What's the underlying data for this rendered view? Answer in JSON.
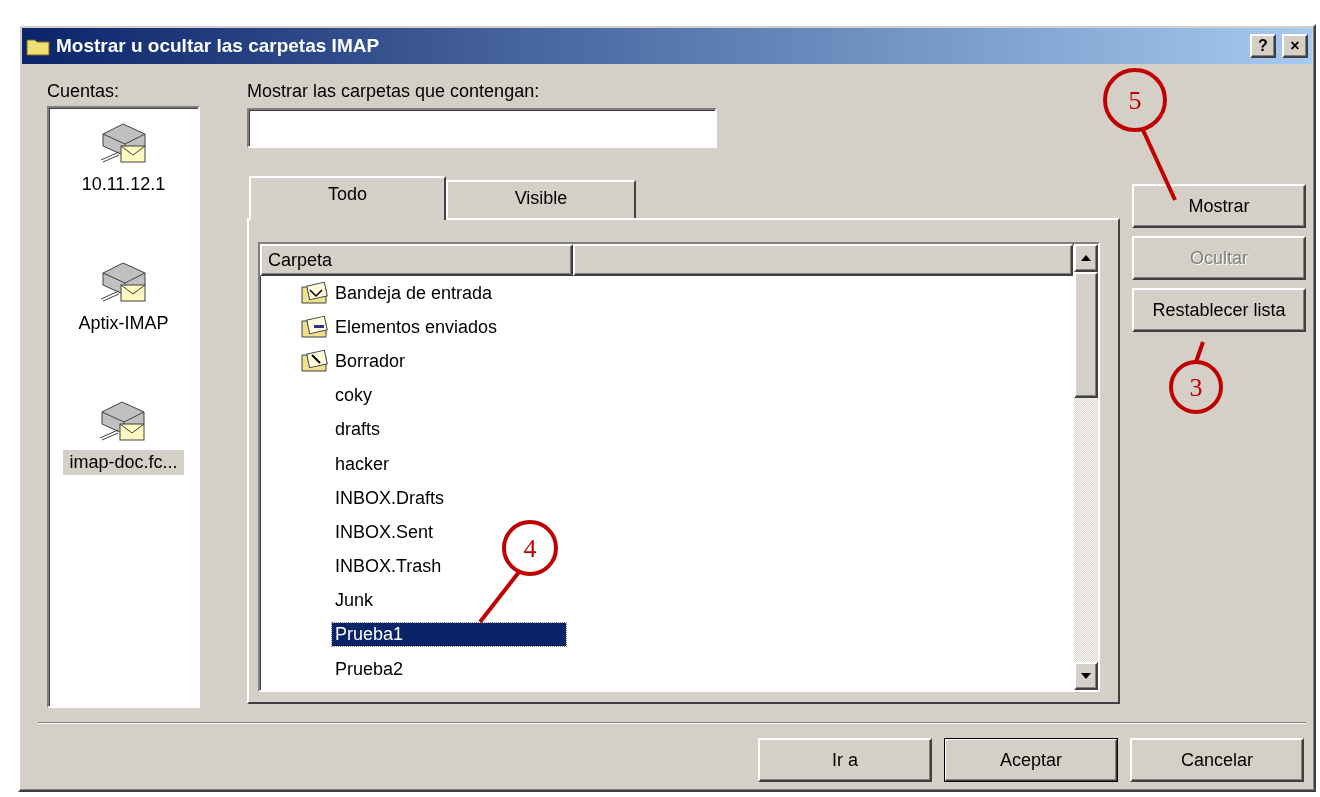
{
  "window": {
    "title": "Mostrar u ocultar las carpetas IMAP",
    "title_buttons": [
      "?",
      "×"
    ]
  },
  "accounts": {
    "label": "Cuentas:",
    "items": [
      {
        "name": "10.11.12.1",
        "selected": false
      },
      {
        "name": "Aptix-IMAP",
        "selected": false
      },
      {
        "name": "imap-doc.fc...",
        "selected": true
      }
    ]
  },
  "filter": {
    "label": "Mostrar las carpetas que contengan:"
  },
  "tabs": [
    {
      "label": "Todo",
      "selected": true
    },
    {
      "label": "Visible",
      "selected": false
    }
  ],
  "table": {
    "columns": [
      "Carpeta"
    ],
    "rows": [
      {
        "name": "Bandeja de entrada",
        "kind": "inbox",
        "selected": false
      },
      {
        "name": "Elementos enviados",
        "kind": "sent",
        "selected": false
      },
      {
        "name": "Borrador",
        "kind": "drafts",
        "selected": false
      },
      {
        "name": "coky",
        "kind": "plain",
        "selected": false
      },
      {
        "name": "drafts",
        "kind": "plain",
        "selected": false
      },
      {
        "name": "hacker",
        "kind": "plain",
        "selected": false
      },
      {
        "name": "INBOX.Drafts",
        "kind": "plain",
        "selected": false
      },
      {
        "name": "INBOX.Sent",
        "kind": "plain",
        "selected": false
      },
      {
        "name": "INBOX.Trash",
        "kind": "plain",
        "selected": false
      },
      {
        "name": "Junk",
        "kind": "plain",
        "selected": false
      },
      {
        "name": "Prueba1",
        "kind": "plain",
        "selected": true
      },
      {
        "name": "Prueba2",
        "kind": "plain",
        "selected": false
      }
    ]
  },
  "side_buttons": [
    {
      "label": "Mostrar",
      "disabled": false
    },
    {
      "label": "Ocultar",
      "disabled": true
    },
    {
      "label": "Restablecer lista",
      "disabled": false
    }
  ],
  "footer_buttons": [
    {
      "label": "Ir a",
      "default": false
    },
    {
      "label": "Aceptar",
      "default": true
    },
    {
      "label": "Cancelar",
      "default": false
    }
  ],
  "annotations": [
    {
      "label": "5"
    },
    {
      "label": "3"
    },
    {
      "label": "4"
    }
  ]
}
